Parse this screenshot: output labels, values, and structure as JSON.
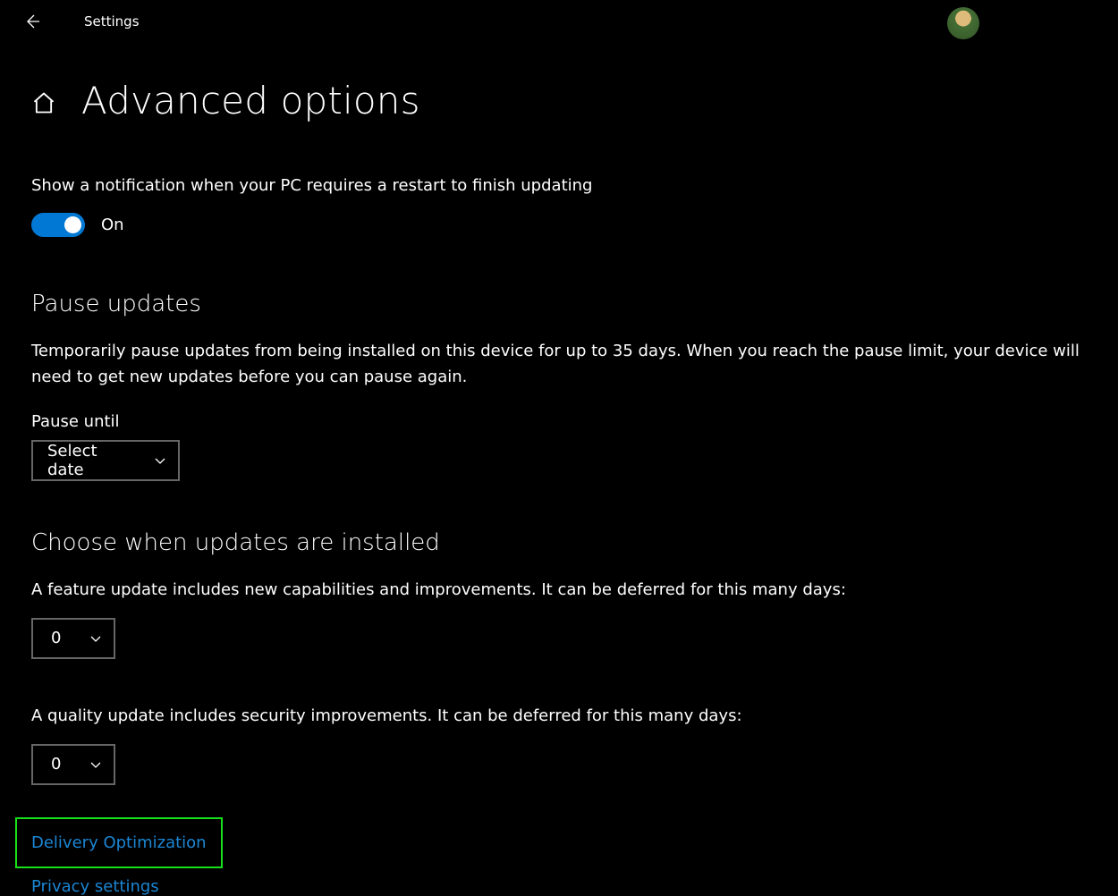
{
  "titlebar": {
    "app_title": "Settings"
  },
  "page": {
    "title": "Advanced options"
  },
  "notification": {
    "label": "Show a notification when your PC requires a restart to finish updating",
    "state_label": "On"
  },
  "pause": {
    "heading": "Pause updates",
    "description": "Temporarily pause updates from being installed on this device for up to 35 days. When you reach the pause limit, your device will need to get new updates before you can pause again.",
    "field_label": "Pause until",
    "dropdown_value": "Select date"
  },
  "schedule": {
    "heading": "Choose when updates are installed",
    "feature_text": "A feature update includes new capabilities and improvements. It can be deferred for this many days:",
    "feature_value": "0",
    "quality_text": "A quality update includes security improvements. It can be deferred for this many days:",
    "quality_value": "0"
  },
  "links": {
    "delivery": "Delivery Optimization",
    "privacy": "Privacy settings"
  }
}
